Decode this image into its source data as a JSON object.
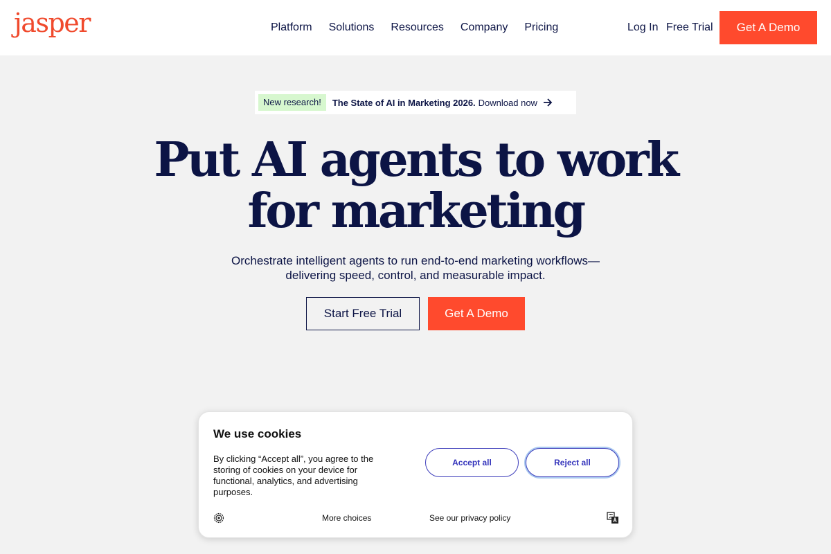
{
  "header": {
    "logo": "jasper",
    "nav": [
      "Platform",
      "Solutions",
      "Resources",
      "Company",
      "Pricing"
    ],
    "login": "Log In",
    "free_trial": "Free Trial",
    "demo": "Get A Demo"
  },
  "announcement": {
    "badge": "New research!",
    "title": "The State of AI in Marketing 2026.",
    "link": "Download now",
    "icon": "arrow-right-icon"
  },
  "hero": {
    "title_line1": "Put AI agents to work",
    "title_line2": "for marketing",
    "subtitle": "Orchestrate intelligent agents to run end-to-end marketing workflows—delivering speed, control, and measurable impact.",
    "cta_secondary": "Start Free Trial",
    "cta_primary": "Get A Demo"
  },
  "cookie": {
    "title": "We use cookies",
    "body": "By clicking “Accept all”, you agree to the storing of cookies on your device for functional, analytics, and advertising purposes.",
    "accept": "Accept all",
    "reject": "Reject all",
    "more": "More choices",
    "privacy": "See our privacy policy"
  },
  "colors": {
    "brand": "#ff4a2d",
    "navy": "#0c1445",
    "badge_bg": "#d7f7cf",
    "cookie_button": "#3333bb"
  }
}
